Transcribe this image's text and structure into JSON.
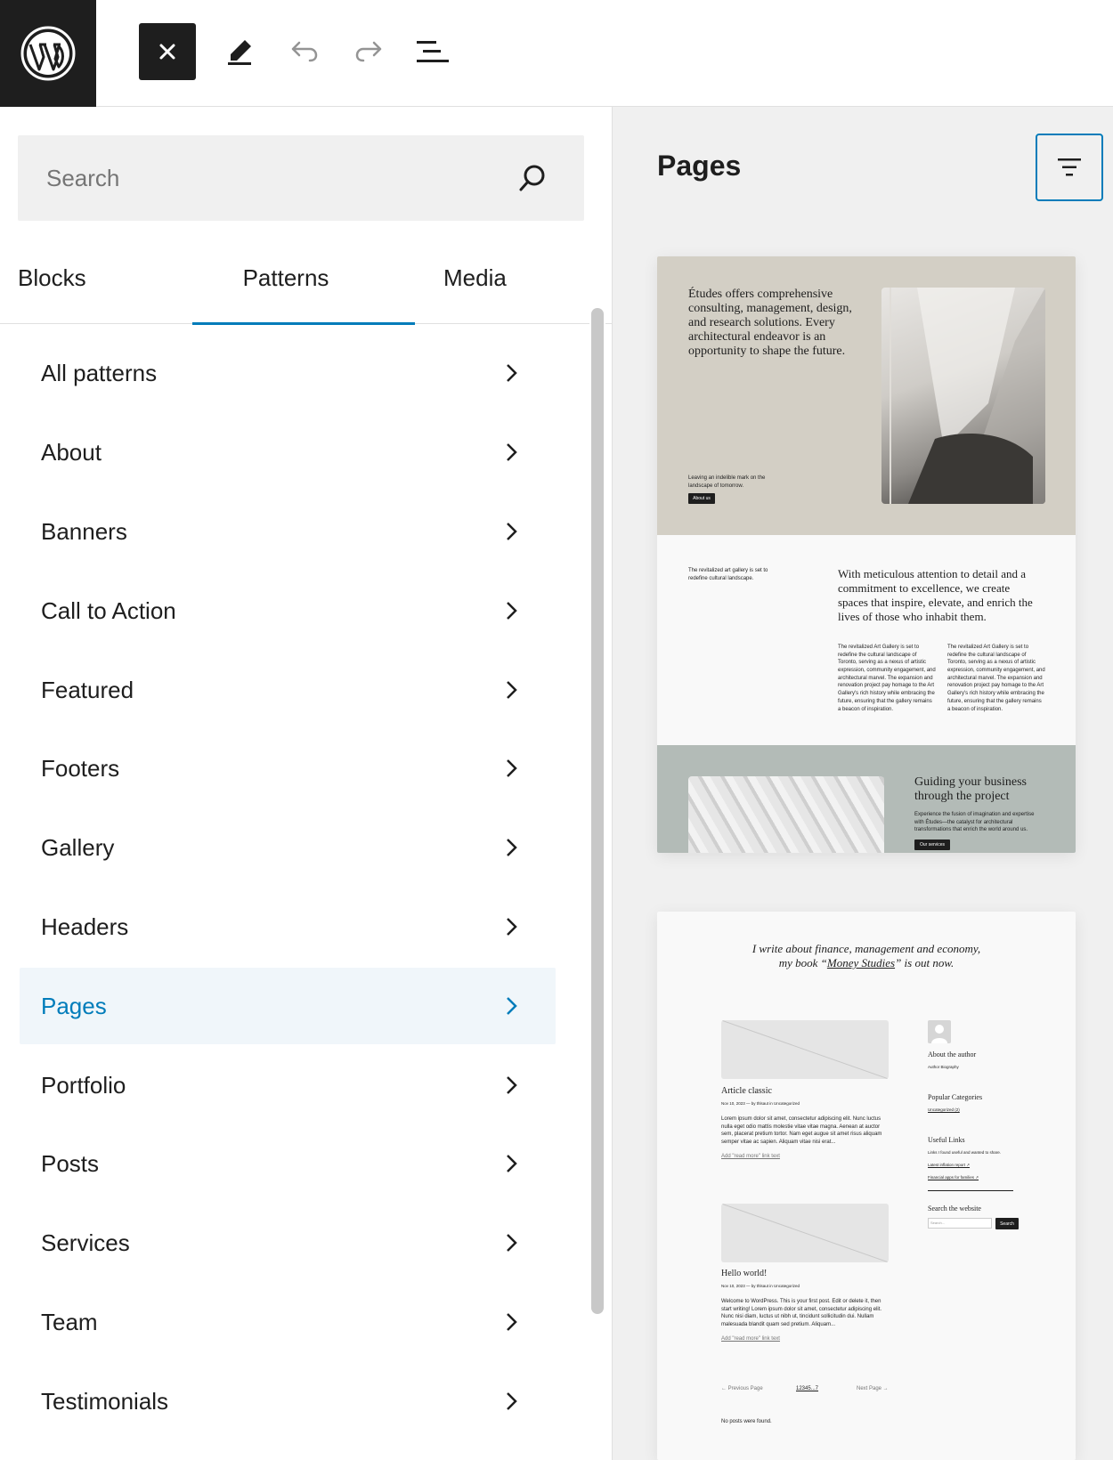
{
  "toolbar": {
    "logo": "wordpress-logo",
    "close_icon": "close-icon",
    "edit_icon": "pencil-icon",
    "undo_icon": "undo-icon",
    "redo_icon": "redo-icon",
    "list_view_icon": "list-view-icon"
  },
  "inserter": {
    "search_placeholder": "Search",
    "tabs": [
      {
        "label": "Blocks"
      },
      {
        "label": "Patterns"
      },
      {
        "label": "Media"
      }
    ],
    "active_tab": "Patterns",
    "categories": [
      {
        "label": "All patterns"
      },
      {
        "label": "About"
      },
      {
        "label": "Banners"
      },
      {
        "label": "Call to Action"
      },
      {
        "label": "Featured"
      },
      {
        "label": "Footers"
      },
      {
        "label": "Gallery"
      },
      {
        "label": "Headers"
      },
      {
        "label": "Pages"
      },
      {
        "label": "Portfolio"
      },
      {
        "label": "Posts"
      },
      {
        "label": "Services"
      },
      {
        "label": "Team"
      },
      {
        "label": "Testimonials"
      }
    ],
    "selected_category": "Pages"
  },
  "preview_panel": {
    "title": "Pages",
    "filter_icon": "filter-icon",
    "card1": {
      "hero_heading": "Études offers comprehensive consulting, management, design, and research solutions. Every architectural endeavor is an opportunity to shape the future.",
      "hero_small": "Leaving an indelible mark on the landscape of tomorrow.",
      "hero_button": "About us",
      "mid_left": "The revitalized art gallery is set to redefine cultural landscape.",
      "mid_quote": "With meticulous attention to detail and a commitment to excellence, we create spaces that inspire, elevate, and enrich the lives of those who inhabit them.",
      "mid_col": "The revitalized Art Gallery is set to redefine the cultural landscape of Toronto, serving as a nexus of artistic expression, community engagement, and architectural marvel. The expansion and renovation project pay homage to the Art Gallery's rich history while embracing the future, ensuring that the gallery remains a beacon of inspiration.",
      "bottom_title": "Guiding your business through the project",
      "bottom_text": "Experience the fusion of imagination and expertise with Études—the catalyst for architectural transformations that enrich the world around us.",
      "bottom_button": "Our services"
    },
    "card2": {
      "quote_part1": "I write about finance, management and economy,",
      "quote_part2": "my book “",
      "quote_link": "Money Studies",
      "quote_part3": "” is out now.",
      "post1": {
        "title": "Article classic",
        "meta": "Nov 10, 2023 — by thlsaut in Uncategorized",
        "excerpt": "Lorem ipsum dolor sit amet, consectetur adipiscing elit. Nunc luctus nulla eget odio mattis molestie vitae vitae magna. Aenean at auctor sem, placerat pretium tortor. Nam eget augue sit amet risus aliquam semper vitae ac sapien. Aliquam vitae nisi erat...",
        "more": "Add \"read more\" link text"
      },
      "post2": {
        "title": "Hello world!",
        "meta": "Nov 10, 2023 — by thlsaut in Uncategorized",
        "excerpt": "Welcome to WordPress. This is your first post. Edit or delete it, then start writing! Lorem ipsum dolor sit amet, consectetur adipiscing elit. Nunc nisi diam, luctus ut nibh ut, tincidunt sollicitudin dui. Nullam malesuada blandit quam sed pretium. Aliquam...",
        "more": "Add \"read more\" link text"
      },
      "sidebar": {
        "about_title": "About the author",
        "about_text": "Author Biography",
        "categories_title": "Popular Categories",
        "categories_link": "Uncategorized (2)",
        "links_title": "Useful Links",
        "links_text": "Links I found useful and wanted to share.",
        "link1": "Latest inflation report ↗",
        "link2": "Financial apps for families ↗",
        "search_title": "Search the website",
        "search_placeholder": "Search...",
        "search_button": "Search"
      },
      "pagination": {
        "prev": "← Previous Page",
        "pages": "12345...7",
        "next": "Next Page →"
      },
      "no_posts": "No posts were found."
    }
  }
}
